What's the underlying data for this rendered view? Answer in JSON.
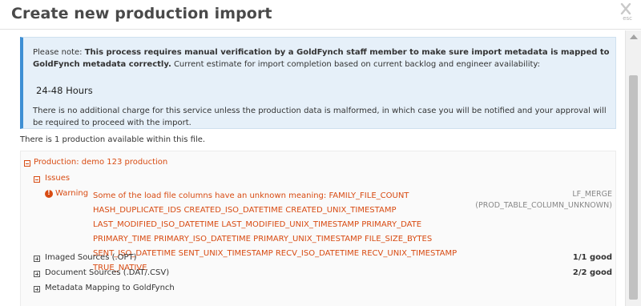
{
  "dialog": {
    "title": "Create new production import",
    "close_glyph": "✕",
    "esc_label": "esc"
  },
  "notice": {
    "intro": "Please note:",
    "bold_text": "This process requires manual verification by a GoldFynch staff member to make sure import metadata is mapped to GoldFynch metadata correctly.",
    "normal_text": "Current estimate for import completion based on current backlog and engineer availability:",
    "time_estimate": "24-48 Hours",
    "footer": "There is no additional charge for this service unless the production data is malformed, in which case you will be notified and your approval will be required to proceed with the import."
  },
  "summary": {
    "count_text": "There is 1 production available within this file."
  },
  "production": {
    "label": "Production: demo 123 production",
    "issues_label": "Issues",
    "warning": {
      "level": "Warning",
      "message": "Some of the load file columns have an unknown meaning: FAMILY_FILE_COUNT HASH_DUPLICATE_IDS CREATED_ISO_DATETIME CREATED_UNIX_TIMESTAMP LAST_MODIFIED_ISO_DATETIME LAST_MODIFIED_UNIX_TIMESTAMP PRIMARY_DATE PRIMARY_TIME PRIMARY_ISO_DATETIME PRIMARY_UNIX_TIMESTAMP FILE_SIZE_BYTES SENT_ISO_DATETIME SENT_UNIX_TIMESTAMP RECV_ISO_DATETIME RECV_UNIX_TIMESTAMP TRUE_NATIVE",
      "code": "LF_MERGE (PROD_TABLE_COLUMN_UNKNOWN)"
    },
    "sections": [
      {
        "label": "Imaged Sources (.OPT)",
        "value": "1/1 good"
      },
      {
        "label": "Document Sources (.DAT/.CSV)",
        "value": "2/2 good"
      },
      {
        "label": "Metadata Mapping to GoldFynch",
        "value": ""
      }
    ]
  },
  "colors": {
    "accent_orange": "#d84b12",
    "notice_bg": "#e6f0f9",
    "notice_border": "#3e8fd4"
  },
  "icons": [
    "close-icon",
    "collapse-icon",
    "expand-icon",
    "warning-icon"
  ]
}
